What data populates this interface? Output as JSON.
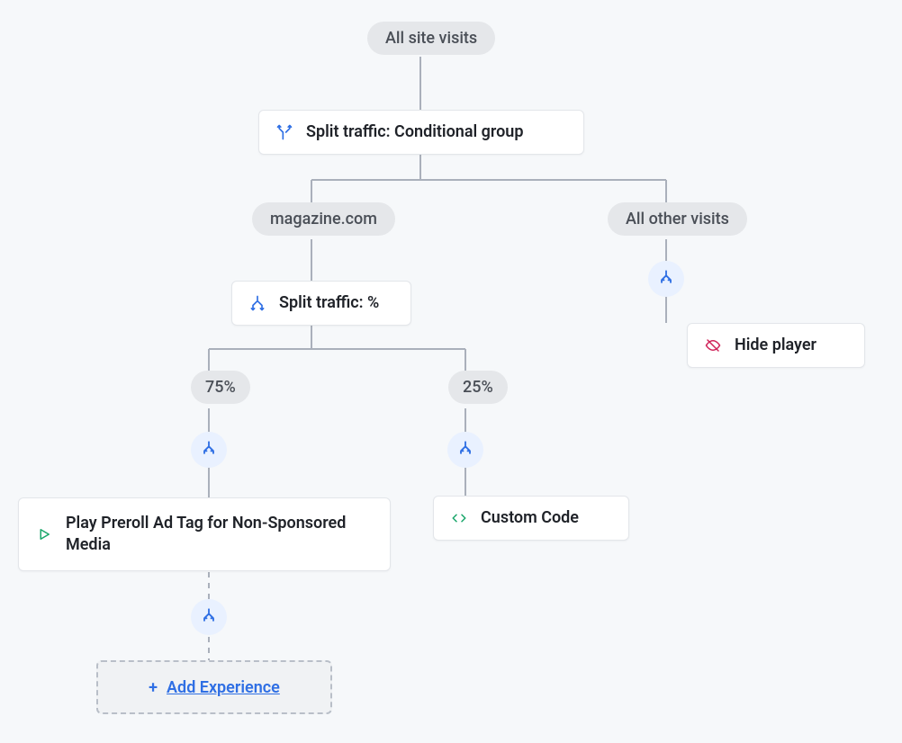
{
  "root": {
    "label": "All site visits"
  },
  "split_conditional": {
    "icon_name": "split-conditional-icon",
    "label": "Split traffic: Conditional group"
  },
  "branch_a": {
    "label": "magazine.com"
  },
  "branch_b": {
    "label": "All other visits"
  },
  "split_percent": {
    "icon_name": "split-percent-icon",
    "label": "Split traffic: %"
  },
  "pct_a": {
    "label": "75%"
  },
  "pct_b": {
    "label": "25%"
  },
  "experience_preroll": {
    "icon_name": "play-icon",
    "label": "Play Preroll Ad Tag for Non-Sponsored Media"
  },
  "experience_custom": {
    "icon_name": "code-icon",
    "label": "Custom Code"
  },
  "experience_hide": {
    "icon_name": "hide-icon",
    "label": "Hide player"
  },
  "add_experience": {
    "plus": "+",
    "label": "Add Experience"
  }
}
